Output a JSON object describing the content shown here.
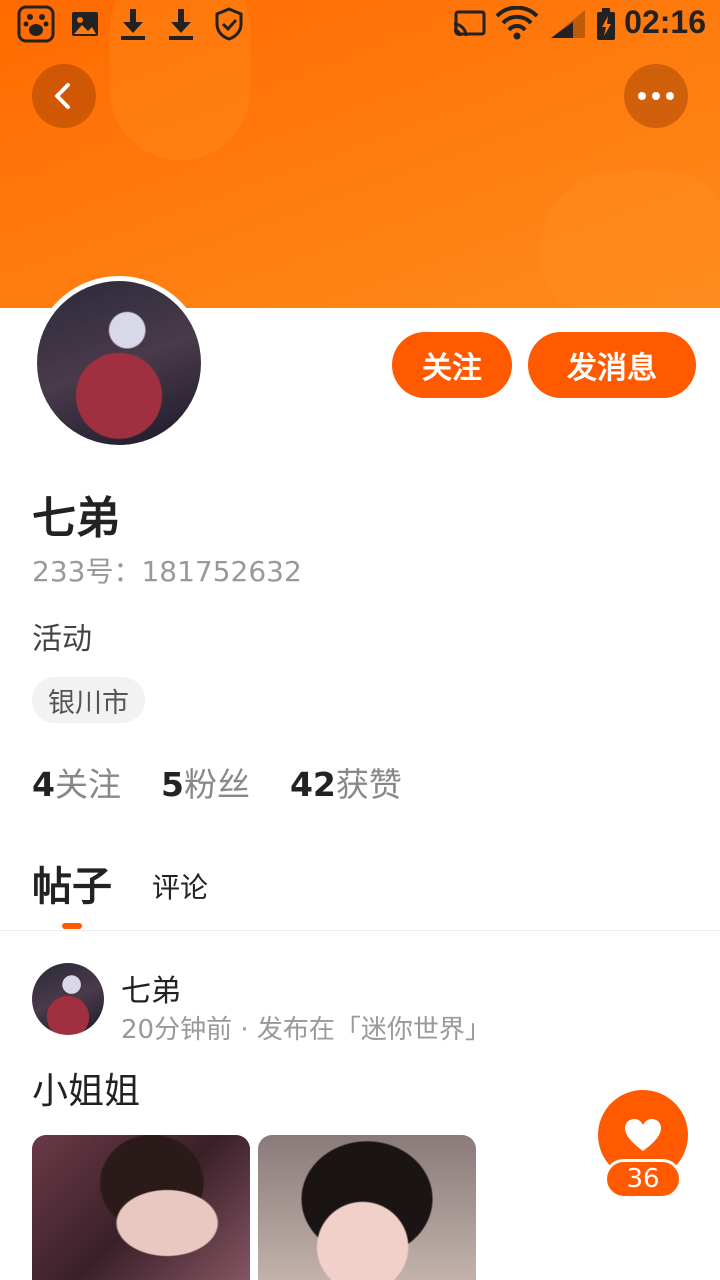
{
  "status_bar": {
    "time": "02:16",
    "icons": [
      "baidu-app-icon",
      "gallery-icon",
      "download-icon",
      "download-icon",
      "shield-icon",
      "cast-icon",
      "wifi-icon",
      "signal-icon",
      "battery-charging-icon"
    ]
  },
  "header": {
    "back_icon": "chevron-left-icon",
    "more_icon": "more-dots-icon",
    "accent_color": "#ff6a00"
  },
  "profile": {
    "follow_label": "关注",
    "message_label": "发消息",
    "name": "七弟",
    "uid": "233号：181752632",
    "bio": "活动",
    "location": "银川市",
    "stats": [
      {
        "num": "4",
        "label": "关注"
      },
      {
        "num": "5",
        "label": "粉丝"
      },
      {
        "num": "42",
        "label": "获赞"
      }
    ]
  },
  "tabs": {
    "active": "帖子",
    "other": "评论"
  },
  "post": {
    "author": "七弟",
    "meta": "20分钟前 · 发布在「迷你世界」",
    "text": "小姐姐",
    "like_count": "36"
  }
}
